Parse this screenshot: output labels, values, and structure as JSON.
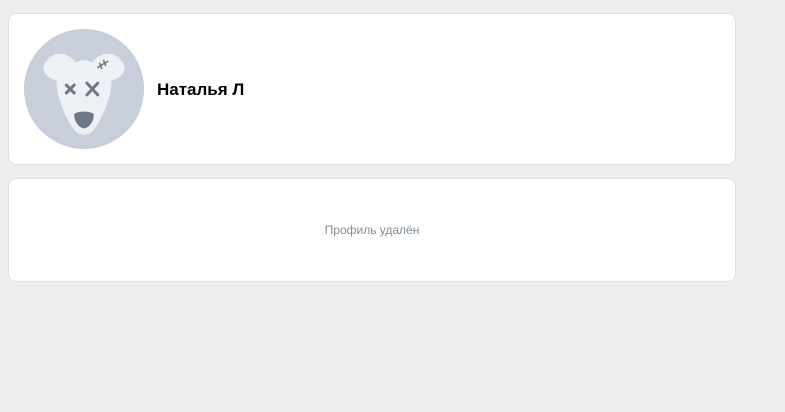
{
  "profile": {
    "name": "Наталья Л",
    "avatar_icon": "deleted-dog-avatar-icon"
  },
  "status": {
    "message": "Профиль удалён"
  },
  "colors": {
    "page_background": "#edeef0",
    "card_background": "#ffffff",
    "avatar_background": "#c8ceda",
    "muted_text": "#818c99",
    "icon_gray": "#6d7885"
  }
}
